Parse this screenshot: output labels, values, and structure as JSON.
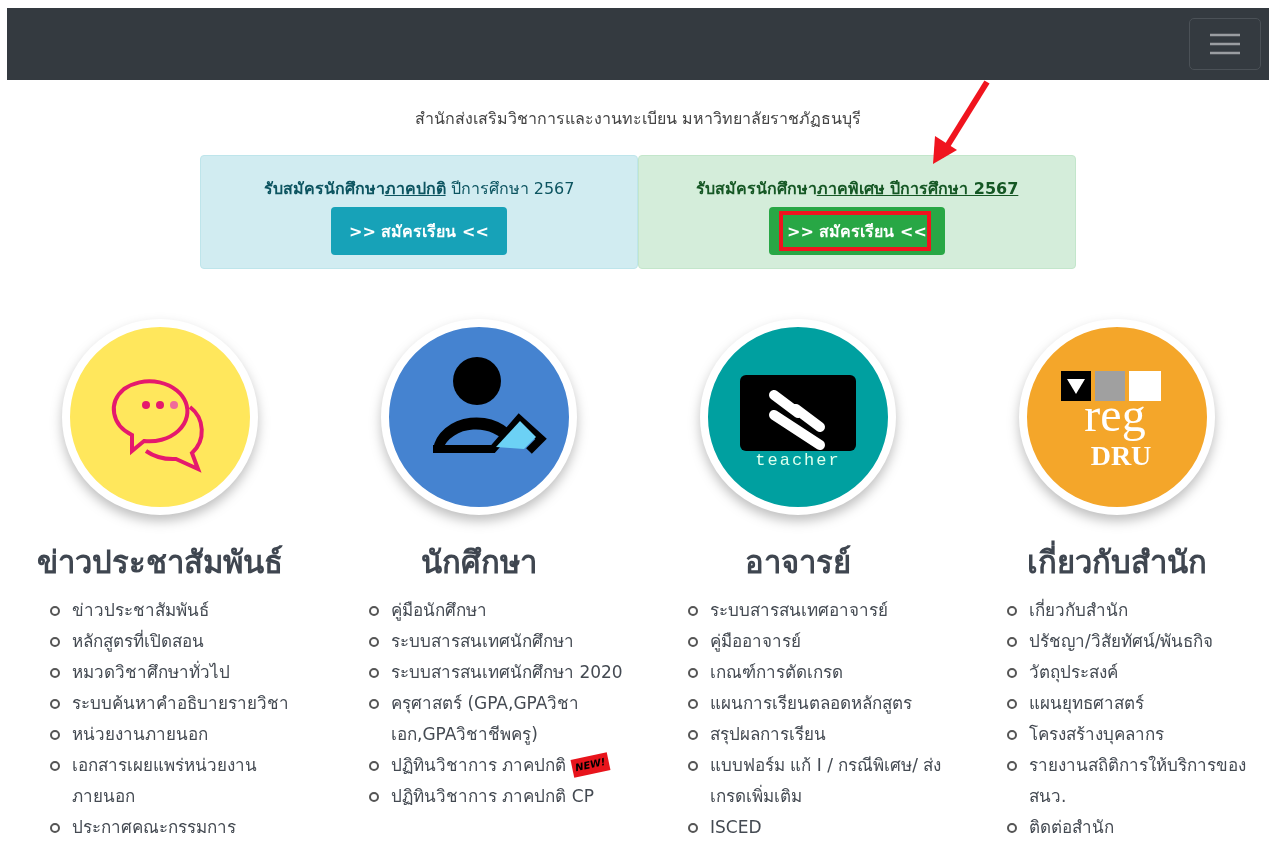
{
  "navbar": {
    "menu_button": true
  },
  "subtitle": "สำนักส่งเสริมวิชาการและงานทะเบียน มหาวิทยาลัยราชภัฏธนบุรี",
  "admission_boxes": [
    {
      "kind": "info",
      "lead": "รับสมัครนักศึกษา",
      "link": "ภาคปกติ",
      "rest": " ปีการศึกษา 2567",
      "button": ">> สมัครเรียน <<",
      "highlighted": false
    },
    {
      "kind": "success",
      "lead": "รับสมัครนักศึกษา",
      "link": "ภาคพิเศษ ปีการศึกษา 2567",
      "button": ">> สมัครเรียน <<",
      "highlighted": true
    }
  ],
  "columns": [
    {
      "icon": {
        "kind": "chat"
      },
      "title": "ข่าวประชาสัมพันธ์",
      "items": [
        {
          "label": "ข่าวประชาสัมพันธ์"
        },
        {
          "label": "หลักสูตรที่เปิดสอน"
        },
        {
          "label": "หมวดวิชาศึกษาทั่วไป"
        },
        {
          "label": "ระบบค้นหาคำอธิบายรายวิชา"
        },
        {
          "label": "หน่วยงานภายนอก"
        },
        {
          "label": "เอกสารเผยแพร่หน่วยงานภายนอก"
        },
        {
          "label": "ประกาศคณะกรรมการ"
        }
      ]
    },
    {
      "icon": {
        "kind": "student"
      },
      "title": "นักศึกษา",
      "items": [
        {
          "label": "คู่มือนักศึกษา"
        },
        {
          "label": "ระบบสารสนเทศนักศึกษา"
        },
        {
          "label": "ระบบสารสนเทศนักศึกษา 2020"
        },
        {
          "label": "ครุศาสตร์ (GPA,GPAวิชาเอก,GPAวิชาชีพครู)"
        },
        {
          "label": "ปฏิทินวิชาการ ภาคปกติ",
          "badge": "NEW!"
        },
        {
          "label": "ปฏิทินวิชาการ ภาคปกติ CP"
        }
      ]
    },
    {
      "icon": {
        "kind": "teacher",
        "text": "teacher"
      },
      "title": "อาจารย์",
      "items": [
        {
          "label": "ระบบสารสนเทศอาจารย์"
        },
        {
          "label": "คู่มืออาจารย์"
        },
        {
          "label": "เกณฑ์การตัดเกรด"
        },
        {
          "label": "แผนการเรียนตลอดหลักสูตร"
        },
        {
          "label": "สรุปผลการเรียน"
        },
        {
          "label": "แบบฟอร์ม แก้ I / กรณีพิเศษ/ ส่งเกรดเพิ่มเติม"
        },
        {
          "label": "ISCED"
        }
      ]
    },
    {
      "icon": {
        "kind": "reg",
        "text": "reg",
        "subtext": "DRU"
      },
      "title": "เกี่ยวกับสำนัก",
      "items": [
        {
          "label": "เกี่ยวกับสำนัก"
        },
        {
          "label": "ปรัชญา/วิสัยทัศน์/พันธกิจ"
        },
        {
          "label": "วัตถุประสงค์"
        },
        {
          "label": "แผนยุทธศาสตร์"
        },
        {
          "label": "โครงสร้างบุคลากร"
        },
        {
          "label": "รายงานสถิติการให้บริการของ สนว."
        },
        {
          "label": "ติดต่อสำนัก"
        }
      ]
    }
  ]
}
